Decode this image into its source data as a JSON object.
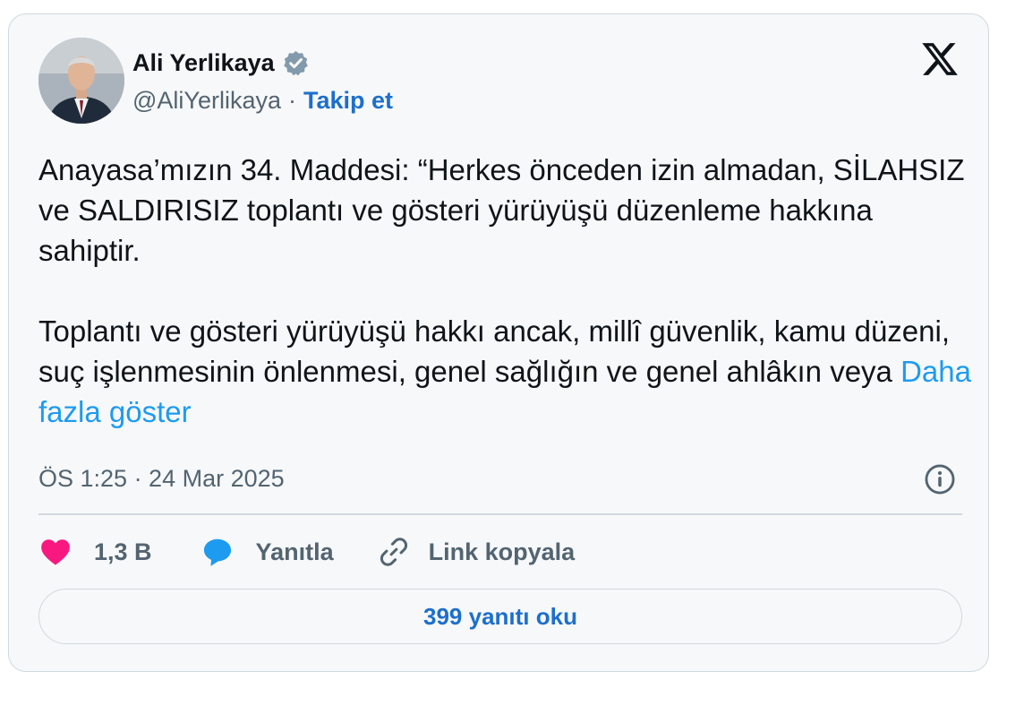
{
  "author": {
    "name": "Ali Yerlikaya",
    "handle": "@AliYerlikaya",
    "separator": "·",
    "follow_label": "Takip et",
    "verified_badge_icon": "verified-badge-icon",
    "avatar": "avatar-photo"
  },
  "platform_logo_icon": "x-logo-icon",
  "tweet": {
    "text": "Anayasa’mızın 34. Maddesi: “Herkes önceden izin almadan, SİLAHSIZ ve SALDIRISIZ toplantı ve gösteri yürüyüşü düzenleme hakkına sahiptir.\n\nToplantı ve gösteri yürüyüşü hakkı ancak, millî güvenlik, kamu düzeni, suç işlenmesinin önlenmesi, genel sağlığın ve genel ahlâkın veya ",
    "show_more_label": "Daha fazla göster",
    "timestamp": "ÖS 1:25 · 24 Mar 2025"
  },
  "actions": {
    "like_count": "1,3 B",
    "reply_label": "Yanıtla",
    "copy_link_label": "Link kopyala"
  },
  "read_replies_label": "399 yanıtı oku",
  "colors": {
    "accent": "#1d9bf0",
    "link_dark": "#1d6fcc",
    "like": "#f91880",
    "verified": "#829aab",
    "muted": "#536471",
    "border": "#cfd9de"
  }
}
